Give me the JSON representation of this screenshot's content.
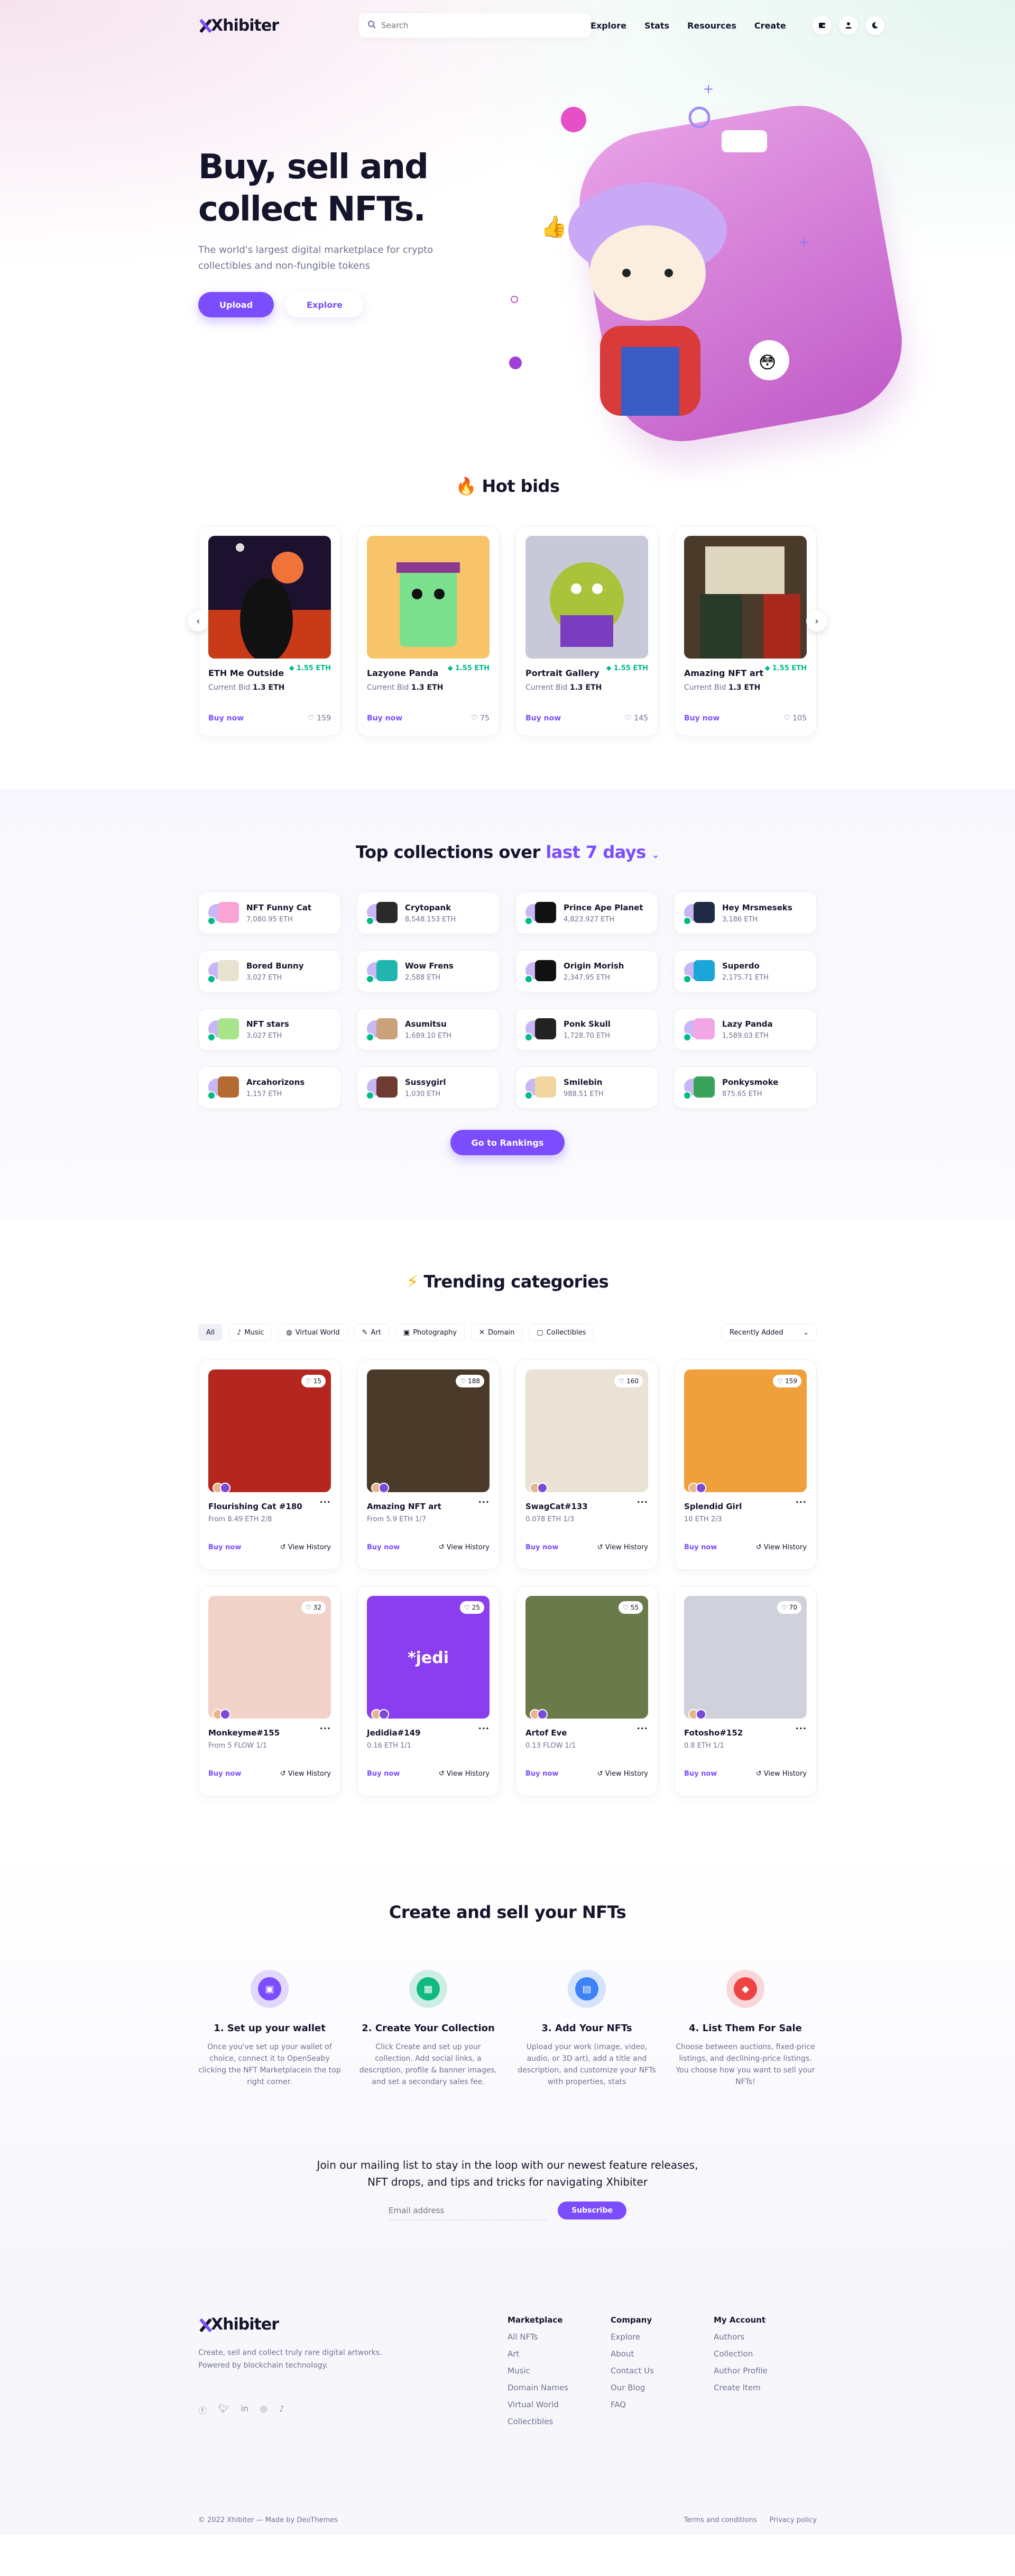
{
  "brand": {
    "name": "Xhibiter",
    "accent": "#7b4dff"
  },
  "header": {
    "search_placeholder": "Search",
    "nav": [
      "Explore",
      "Stats",
      "Resources",
      "Create"
    ]
  },
  "hero": {
    "title_line1": "Buy, sell and",
    "title_line2": "collect NFTs.",
    "subtitle": "The world's largest digital marketplace for crypto collectibles and non-fungible tokens",
    "upload": "Upload",
    "explore": "Explore"
  },
  "hot": {
    "title": "Hot bids",
    "cards": [
      {
        "title": "ETH Me Outside",
        "eth": "1.55 ETH",
        "bid_label": "Current Bid",
        "bid": "1.3 ETH",
        "buy": "Buy now",
        "likes": "159"
      },
      {
        "title": "Lazyone Panda",
        "eth": "1.55 ETH",
        "bid_label": "Current Bid",
        "bid": "1.3 ETH",
        "buy": "Buy now",
        "likes": "75"
      },
      {
        "title": "Portrait Gallery",
        "eth": "1.55 ETH",
        "bid_label": "Current Bid",
        "bid": "1.3 ETH",
        "buy": "Buy now",
        "likes": "145"
      },
      {
        "title": "Amazing NFT art",
        "eth": "1.55 ETH",
        "bid_label": "Current Bid",
        "bid": "1.3 ETH",
        "buy": "Buy now",
        "likes": "105"
      }
    ]
  },
  "top": {
    "title_prefix": "Top collections over",
    "title_period": "last 7 days",
    "button": "Go to Rankings",
    "items": [
      {
        "name": "NFT Funny Cat",
        "value": "7,080.95 ETH"
      },
      {
        "name": "Crytopank",
        "value": "8,548.153 ETH"
      },
      {
        "name": "Prince Ape Planet",
        "value": "4,823.927 ETH"
      },
      {
        "name": "Hey Mrsmeseks",
        "value": "3,186 ETH"
      },
      {
        "name": "Bored Bunny",
        "value": "3,027 ETH"
      },
      {
        "name": "Wow Frens",
        "value": "2,588 ETH"
      },
      {
        "name": "Origin Morish",
        "value": "2,347.95 ETH"
      },
      {
        "name": "Superdo",
        "value": "2,175.71 ETH"
      },
      {
        "name": "NFT stars",
        "value": "3,027 ETH"
      },
      {
        "name": "Asumitsu",
        "value": "1,689.10 ETH"
      },
      {
        "name": "Ponk Skull",
        "value": "1,728.70 ETH"
      },
      {
        "name": "Lazy Panda",
        "value": "1,589.03 ETH"
      },
      {
        "name": "Arcahorizons",
        "value": "1,157 ETH"
      },
      {
        "name": "Sussygirl",
        "value": "1,030 ETH"
      },
      {
        "name": "Smilebin",
        "value": "988.51 ETH"
      },
      {
        "name": "Ponkysmoke",
        "value": "875.65 ETH"
      }
    ]
  },
  "trend": {
    "title": "Trending categories",
    "filters": [
      "All",
      "Music",
      "Virtual World",
      "Art",
      "Photography",
      "Domain",
      "Collectibles"
    ],
    "sort": "Recently Added",
    "cards": [
      {
        "title": "Flourishing Cat #180",
        "price": "From 8.49 ETH 2/8",
        "likes": "15",
        "buy": "Buy now",
        "history": "View History"
      },
      {
        "title": "Amazing NFT art",
        "price": "From 5.9 ETH 1/7",
        "likes": "188",
        "buy": "Buy now",
        "history": "View History"
      },
      {
        "title": "SwagCat#133",
        "price": "0.078 ETH 1/3",
        "likes": "160",
        "buy": "Buy now",
        "history": "View History"
      },
      {
        "title": "Splendid Girl",
        "price": "10 ETH 2/3",
        "likes": "159",
        "buy": "Buy now",
        "history": "View History"
      },
      {
        "title": "Monkeyme#155",
        "price": "From 5 FLOW 1/1",
        "likes": "32",
        "buy": "Buy now",
        "history": "View History"
      },
      {
        "title": "Jedidia#149",
        "price": "0.16 ETH 1/1",
        "likes": "25",
        "buy": "Buy now",
        "history": "View History"
      },
      {
        "title": "Artof Eve",
        "price": "0.13 FLOW 1/1",
        "likes": "55",
        "buy": "Buy now",
        "history": "View History"
      },
      {
        "title": "Fotosho#152",
        "price": "0.8 ETH 1/1",
        "likes": "70",
        "buy": "Buy now",
        "history": "View History"
      }
    ]
  },
  "create": {
    "title": "Create and sell your NFTs",
    "steps": [
      {
        "title": "1. Set up your wallet",
        "text": "Once you've set up your wallet of choice, connect it to OpenSeaby clicking the NFT Marketplacein the top right corner.",
        "color": "#7b4dff"
      },
      {
        "title": "2. Create Your Collection",
        "text": "Click Create and set up your collection. Add social links, a description, profile & banner images, and set a secondary sales fee.",
        "color": "#10b981"
      },
      {
        "title": "3. Add Your NFTs",
        "text": "Upload your work (image, video, audio, or 3D art), add a title and description, and customize your NFTs with properties, stats",
        "color": "#3b82f6"
      },
      {
        "title": "4. List Them For Sale",
        "text": "Choose between auctions, fixed-price listings, and declining-price listings. You choose how you want to sell your NFTs!",
        "color": "#ef4444"
      }
    ],
    "mail_line1": "Join our mailing list to stay in the loop with our newest feature releases,",
    "mail_line2": "NFT drops, and tips and tricks for navigating Xhibiter",
    "email_placeholder": "Email address",
    "subscribe": "Subscribe"
  },
  "footer": {
    "text": "Create, sell and collect truly rare digital artworks. Powered by blockchain technology.",
    "cols": [
      {
        "title": "Marketplace",
        "links": [
          "All NFTs",
          "Art",
          "Music",
          "Domain Names",
          "Virtual World",
          "Collectibles"
        ]
      },
      {
        "title": "Company",
        "links": [
          "Explore",
          "About",
          "Contact Us",
          "Our Blog",
          "FAQ"
        ]
      },
      {
        "title": "My Account",
        "links": [
          "Authors",
          "Collection",
          "Author Profile",
          "Create Item"
        ]
      }
    ],
    "copyright": "© 2022 Xhibiter — Made by DeoThemes",
    "terms": "Terms and conditions",
    "privacy": "Privacy policy"
  }
}
